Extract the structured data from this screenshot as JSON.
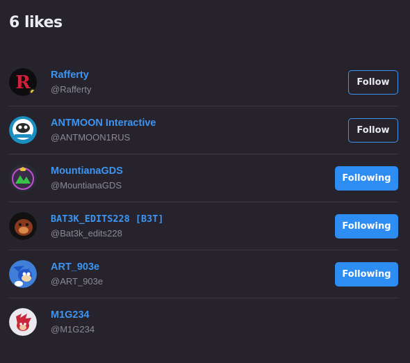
{
  "header": {
    "title": "6 likes"
  },
  "users": [
    {
      "name": "Rafferty",
      "handle": "@Rafferty",
      "button": "Follow",
      "state": "follow",
      "icon": "rafferty-avatar"
    },
    {
      "name": "ANTMOON Interactive",
      "handle": "@ANTMOON1RUS",
      "button": "Follow",
      "state": "follow",
      "icon": "antmoon-avatar"
    },
    {
      "name": "MountianaGDS",
      "handle": "@MountianaGDS",
      "button": "Following",
      "state": "following",
      "icon": "mountiana-avatar"
    },
    {
      "name": "BAT3K_EDITS228 [B3T]",
      "handle": "@Bat3k_edits228",
      "button": "Following",
      "state": "following",
      "icon": "bat3k-avatar"
    },
    {
      "name": "ART_903e",
      "handle": "@ART_903e",
      "button": "Following",
      "state": "following",
      "icon": "art903e-avatar"
    },
    {
      "name": "M1G234",
      "handle": "@M1G234",
      "button": "",
      "state": "none",
      "icon": "m1g234-avatar"
    }
  ],
  "colors": {
    "background": "#26232c",
    "accent": "#2e8df3",
    "link": "#3d95f2",
    "muted": "#8c8a96"
  }
}
